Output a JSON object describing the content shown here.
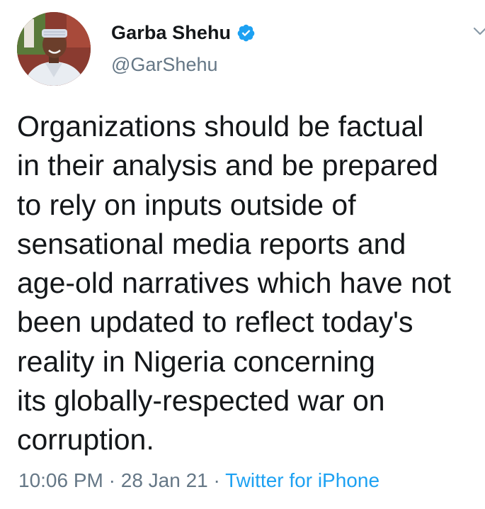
{
  "author": {
    "display_name": "Garba Shehu",
    "handle": "@GarShehu",
    "verified": true,
    "avatar_icon": "profile-photo",
    "verified_icon": "verified-badge-icon"
  },
  "menu": {
    "icon": "chevron-down-icon"
  },
  "tweet": {
    "lines": [
      "Organizations should be factual",
      "in their analysis and be prepared",
      "to rely on inputs outside of",
      "sensational media reports and",
      "age-old narratives which have not",
      "been updated to reflect today's",
      "reality in Nigeria concerning",
      "its globally-respected war on",
      "corruption."
    ]
  },
  "meta": {
    "time": "10:06 PM",
    "separator": " · ",
    "date": "28 Jan 21",
    "source": "Twitter for iPhone"
  },
  "colors": {
    "text": "#14171a",
    "secondary": "#657786",
    "accent": "#1da1f2",
    "background": "#ffffff"
  }
}
